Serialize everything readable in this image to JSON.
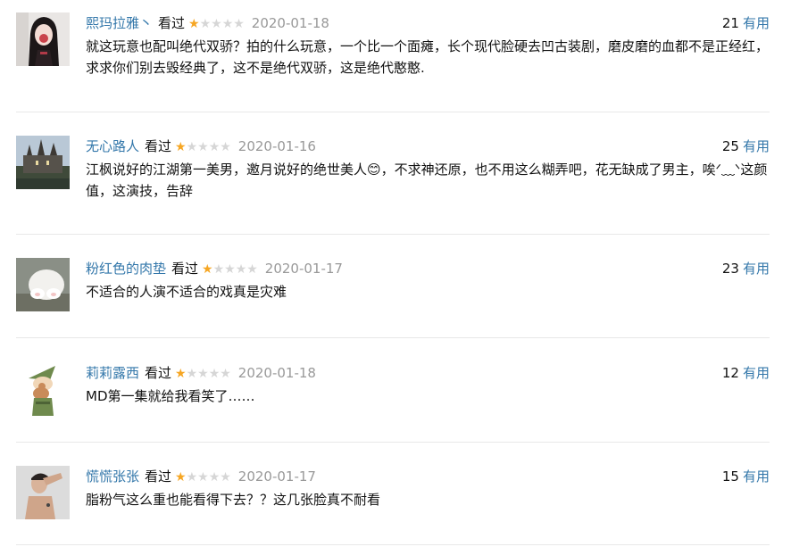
{
  "reviews": [
    {
      "author": "熙玛拉雅丶",
      "status": "看过",
      "rating": 1,
      "date": "2020-01-18",
      "votes": "21",
      "useful_label": "有用",
      "avatar_icon": "girl-portrait-avatar",
      "content": "就这玩意也配叫绝代双骄？拍的什么玩意，一个比一个面瘫，长个现代脸硬去凹古装剧，磨皮磨的血都不是正经红，求求你们别去毁经典了，这不是绝代双骄，这是绝代憨憨."
    },
    {
      "author": "无心路人",
      "status": "看过",
      "rating": 1,
      "date": "2020-01-16",
      "votes": "25",
      "useful_label": "有用",
      "avatar_icon": "castle-avatar",
      "content": "江枫说好的江湖第一美男，邀月说好的绝世美人😊，不求神还原，也不用这么糊弄吧，花无缺成了男主，唉ᐟ﹏ᐠ这颜值，这演技，告辞"
    },
    {
      "author": "粉红色的肉垫",
      "status": "看过",
      "rating": 1,
      "date": "2020-01-17",
      "votes": "23",
      "useful_label": "有用",
      "avatar_icon": "cat-paw-avatar",
      "content": "不适合的人演不适合的戏真是灾难"
    },
    {
      "author": "莉莉露西",
      "status": "看过",
      "rating": 1,
      "date": "2020-01-18",
      "votes": "12",
      "useful_label": "有用",
      "avatar_icon": "cartoon-gnome-avatar",
      "content": "MD第一集就给我看笑了……"
    },
    {
      "author": "慌慌张张",
      "status": "看过",
      "rating": 1,
      "date": "2020-01-17",
      "votes": "15",
      "useful_label": "有用",
      "avatar_icon": "saluting-man-avatar",
      "content": "脂粉气这么重也能看得下去？？这几张脸真不耐看"
    }
  ],
  "colors": {
    "link": "#3377aa",
    "star": "#f6a623",
    "star_empty": "#d6d6d6",
    "date": "#999999",
    "divider": "#e8e8e8"
  }
}
